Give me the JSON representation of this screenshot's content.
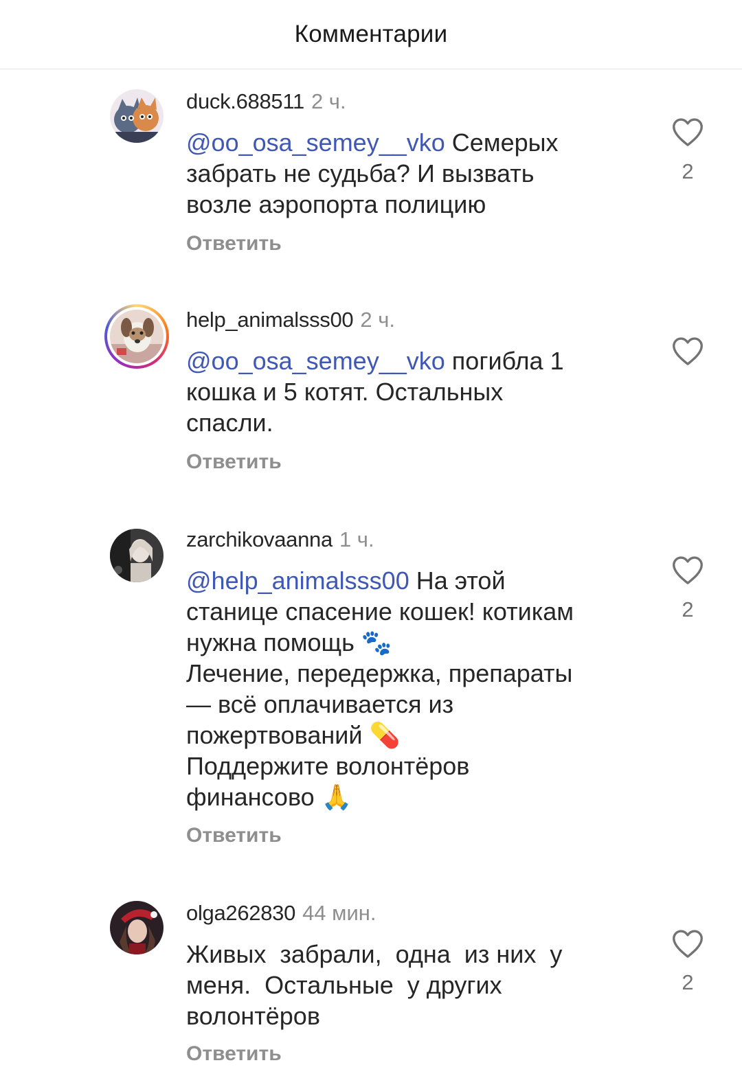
{
  "header": {
    "title": "Комментарии"
  },
  "comments": [
    {
      "username": "duck.688511",
      "time": "2 ч.",
      "mention": "@oo_osa_semey__vko",
      "lines": [
        "Семерых",
        "забрать не судьба? И вызвать",
        "возле аэропорта полицию"
      ],
      "reply_label": "Ответить",
      "likes": "2",
      "avatar_icon": "cartoon-cats-avatar"
    },
    {
      "username": "help_animalsss00",
      "time": "2 ч.",
      "mention": "@oo_osa_semey__vko",
      "lines": [
        "погибла 1",
        "кошка и 5 котят. Остальных",
        "спасли."
      ],
      "reply_label": "Ответить",
      "likes": "",
      "avatar_icon": "dog-avatar-with-story-ring"
    },
    {
      "username": "zarchikovaanna",
      "time": "1 ч.",
      "mention": "@help_animalsss00",
      "lines": [
        "На этой",
        "станице спасение кошек! котикам",
        "нужна помощь 🐾",
        "Лечение, передержка, препараты",
        "— всё оплачивается из",
        "пожертвований 💊",
        "Поддержите волонтёров",
        "финансово 🙏"
      ],
      "reply_label": "Ответить",
      "likes": "2",
      "avatar_icon": "woman-photo-avatar"
    },
    {
      "username": "olga262830",
      "time": "44 мин.",
      "mention": "",
      "lines": [
        "Живых  забрали,  одна  из них  у",
        "меня.  Остальные  у других",
        "волонтёров"
      ],
      "reply_label": "Ответить",
      "likes": "2",
      "avatar_icon": "woman-red-hat-avatar"
    }
  ],
  "colors": {
    "mention": "#3f57b5",
    "secondary_text": "#8e8e8e",
    "primary_text": "#262626"
  }
}
